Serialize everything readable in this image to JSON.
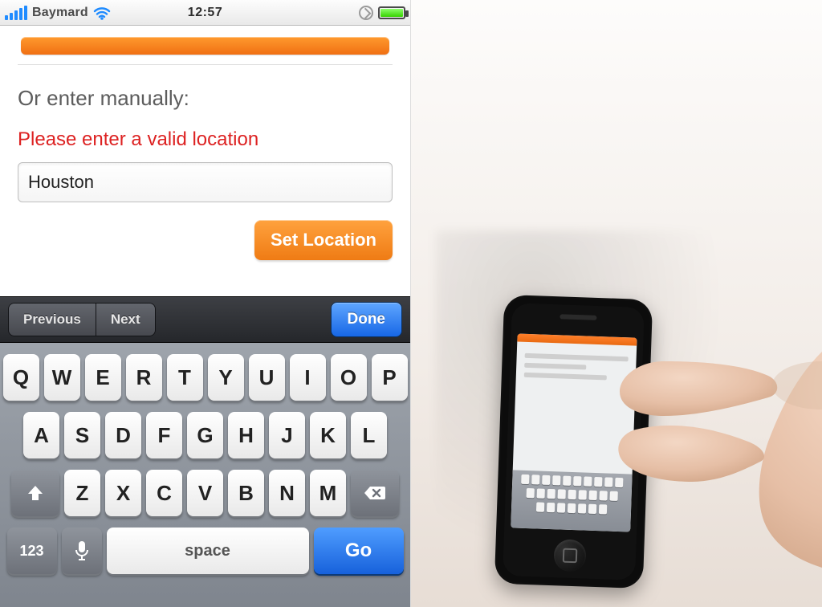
{
  "statusbar": {
    "carrier": "Baymard",
    "time": "12:57"
  },
  "page": {
    "manual_label": "Or enter manually:",
    "error_msg": "Please enter a valid location",
    "location_value": "Houston",
    "set_location_label": "Set Location"
  },
  "assist": {
    "prev": "Previous",
    "next": "Next",
    "done": "Done"
  },
  "keyboard": {
    "rows": [
      [
        "Q",
        "W",
        "E",
        "R",
        "T",
        "Y",
        "U",
        "I",
        "O",
        "P"
      ],
      [
        "A",
        "S",
        "D",
        "F",
        "G",
        "H",
        "J",
        "K",
        "L"
      ],
      [
        "Z",
        "X",
        "C",
        "V",
        "B",
        "N",
        "M"
      ]
    ],
    "k123": "123",
    "space": "space",
    "go": "Go"
  }
}
